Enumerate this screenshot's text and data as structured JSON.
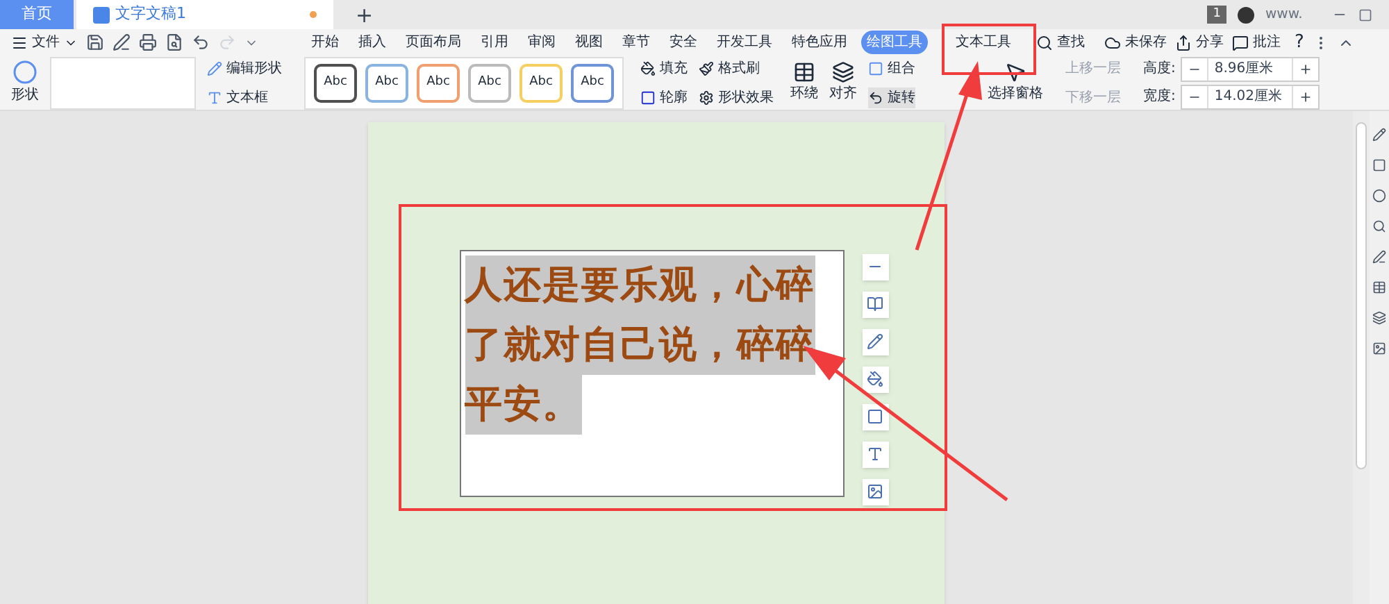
{
  "title_bar": {
    "tabs": [
      {
        "label": "首页",
        "selected": true
      },
      {
        "label": "文字文稿1",
        "selected": false,
        "unsaved": true
      }
    ],
    "new_tab": "+",
    "badge": "1",
    "user": "www."
  },
  "menu": {
    "file": "文件",
    "tabs": [
      {
        "label": "开始",
        "selected": false
      },
      {
        "label": "插入",
        "selected": false
      },
      {
        "label": "页面布局",
        "selected": false
      },
      {
        "label": "引用",
        "selected": false
      },
      {
        "label": "审阅",
        "selected": false
      },
      {
        "label": "视图",
        "selected": false
      },
      {
        "label": "章节",
        "selected": false
      },
      {
        "label": "安全",
        "selected": false
      },
      {
        "label": "开发工具",
        "selected": false
      },
      {
        "label": "特色应用",
        "selected": false
      },
      {
        "label": "绘图工具",
        "selected": true
      },
      {
        "label": "文本工具",
        "selected": false
      }
    ],
    "search": "查找",
    "actions": [
      "未保存",
      "分享",
      "批注"
    ],
    "help": "?"
  },
  "ribbon": {
    "shape": "形状",
    "edit_shape": "编辑形状",
    "text_box": "文本框",
    "styles": [
      {
        "label": "Abc",
        "color": "#505050"
      },
      {
        "label": "Abc",
        "color": "#8ab4e0"
      },
      {
        "label": "Abc",
        "color": "#f0a070"
      },
      {
        "label": "Abc",
        "color": "#bbbbbb"
      },
      {
        "label": "Abc",
        "color": "#f5d060"
      },
      {
        "label": "Abc",
        "color": "#7094d8"
      }
    ],
    "fill": "填充",
    "format_painter": "格式刷",
    "outline": "轮廓",
    "shape_effects": "形状效果",
    "wrap": "环绕",
    "align": "对齐",
    "group": "组合",
    "rotate": "旋转",
    "selection_pane": "选择窗格",
    "bring_forward": {
      "label": "上移一层",
      "disabled": true
    },
    "send_backward": {
      "label": "下移一层",
      "disabled": true
    },
    "height": {
      "label": "高度:",
      "value": "8.96厘米"
    },
    "width": {
      "label": "宽度:",
      "value": "14.02厘米"
    }
  },
  "document": {
    "text_lines": [
      "人还是要乐观，心碎",
      "了就对自己说，碎碎",
      "平安。"
    ]
  }
}
